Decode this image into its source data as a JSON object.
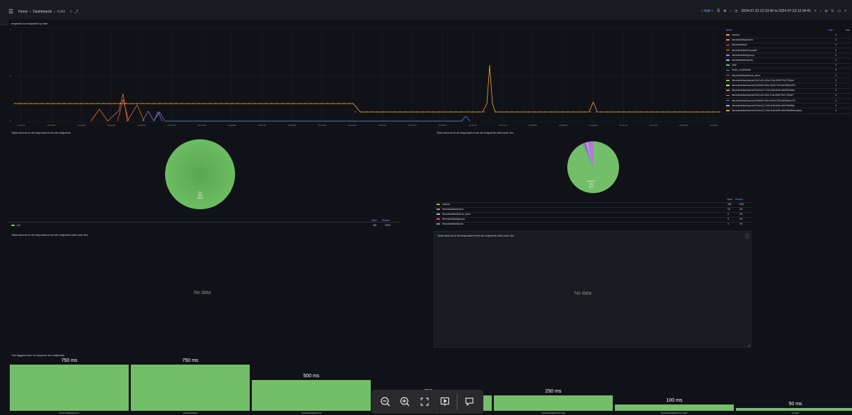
{
  "breadcrumb": [
    "Home",
    "Dashboards",
    "Kafdl"
  ],
  "topbar": {
    "add": "Add",
    "time_range": "2024-07-23 12:10:40 to 2024-07-23 12:34:41"
  },
  "panels": {
    "timeseries": {
      "title": "requests to endpoints by time",
      "legend_header": {
        "name": "Name",
        "last": "Last *",
        "max": "Max"
      },
      "legend": [
        {
          "name": "/metrics",
          "color": "#f2a93b",
          "last": "0"
        },
        {
          "name": "/tenants/default/users",
          "color": "#ff7a2e",
          "last": "0"
        },
        {
          "name": "/tenants/default",
          "color": "#ff5f3a",
          "last": "0"
        },
        {
          "name": "/tenants/default/corporate",
          "color": "#ff9830",
          "last": "0"
        },
        {
          "name": "/tenants/default/groups",
          "color": "#b877d9",
          "last": "0"
        },
        {
          "name": "/tenants/default/posts",
          "color": "#8ab8ff",
          "last": "0"
        },
        {
          "name": "/auth",
          "color": "#73bf69",
          "last": "0"
        },
        {
          "name": "/redoc_conf/default",
          "color": "#5794f2",
          "last": "0"
        },
        {
          "name": "/tenants/default/check_token",
          "color": "#f2495c",
          "last": "0"
        },
        {
          "name": "/tenants/default/users/e23c7c12c-f10e-47a6-89f5-97b1729bbe7",
          "color": "#73bf69",
          "last": "0"
        },
        {
          "name": "/tenants/default/users/c22c5525-09be-4450-9705-6603f9ebc975",
          "color": "#fade2a",
          "last": "0"
        },
        {
          "name": "/tenants/default/users/e21efcc12-17e8-4e6d-8ef5-c6fb7f6d5bba",
          "color": "#b877d9",
          "last": "0"
        },
        {
          "name": "/tenants/default/users/e23c7c12c-ff1d-47a6-89f5-97b1729bbe7",
          "color": "#ff7383",
          "last": "0"
        },
        {
          "name": "/tenants/default/users/c23c5525-09be-4450-9705-6603f9ebc975",
          "color": "#5794f2",
          "last": "0"
        },
        {
          "name": "/tenants/default/users/e21efcc12-17e8-4e6d-8ef5-c6fb7f6d5bba",
          "color": "#8ab8ff",
          "last": "0"
        },
        {
          "name": "/tenants/default/users/e21efcc12-17e8-4e6d-8ef5-c6fb7f6d5bba/replica",
          "color": "#ff9830",
          "last": "0"
        }
      ],
      "yticks": [
        "2",
        "1",
        "0"
      ],
      "xticks": [
        "13:11:00",
        "13:12:00",
        "13:13:00",
        "13:14:00",
        "13:15:00",
        "13:16:00",
        "13:17:00",
        "13:18:00",
        "13:19:00",
        "13:20:00",
        "13:21:00",
        "13:22:00",
        "13:23:00",
        "13:24:00",
        "13:25:00",
        "13:26:00",
        "13:27:00",
        "13:28:00",
        "13:29:00",
        "13:30:00",
        "13:31:00",
        "13:32:00",
        "13:33:00",
        "13:34:00"
      ]
    },
    "pie_all": {
      "title": "Total amount of all responses from all endpoints",
      "slice_label": "2xx",
      "slice_value": "463",
      "slice_pct": "100%",
      "legend_header": {
        "value": "Value",
        "percent": "Percent"
      },
      "legend": [
        {
          "name": "2xx",
          "value": "463",
          "pct": "100%",
          "color": "#73bf69"
        }
      ]
    },
    "pie_2xx": {
      "title": "Total amount of all responses from all endpoints with code 2xx",
      "slice_label": "/metrics",
      "slice_value": "439",
      "slice_pct": "94%",
      "legend_header": {
        "value": "Value",
        "percent": "Percent"
      },
      "legend": [
        {
          "name": "/metrics",
          "value": "439",
          "pct": "94%",
          "color": "#73bf69"
        },
        {
          "name": "/tenants/default/users",
          "value": "15",
          "pct": "3%",
          "color": "#b877d9"
        },
        {
          "name": "/tenants/default/check_token",
          "value": "3",
          "pct": "1%",
          "color": "#8ab8ff"
        },
        {
          "name": "/tenants/default/groups",
          "value": "3",
          "pct": "1%",
          "color": "#f2495c"
        },
        {
          "name": "/tenants/default/posts",
          "value": "3",
          "pct": "1%",
          "color": "#5794f2"
        }
      ]
    },
    "code5xx": {
      "title": "Total amount of all responses from all endpoints with code 5xx",
      "empty": "No data"
    },
    "code4xx": {
      "title": "Total amount of all responses from all endpoints with code 4xx",
      "empty": "No data"
    },
    "biggest": {
      "title": "The biggest time of response for endpoints"
    }
  },
  "chart_data": {
    "type": "bar",
    "title": "The biggest time of response for endpoints",
    "categories": [
      "/tenants/default/users",
      "/tenants/default",
      "/tenants/default/posts",
      "/tenants/default/groups",
      "/tenants/default/corporate",
      "/tenants/default/check_token",
      "/metrics"
    ],
    "values": [
      750,
      750,
      500,
      250,
      250,
      100,
      50
    ],
    "value_labels": [
      "750 ms",
      "750 ms",
      "500 ms",
      "250 ms",
      "250 ms",
      "100 ms",
      "50 ms"
    ],
    "ylim": [
      0,
      750
    ]
  },
  "zoom_toolbar": [
    "zoom-out",
    "zoom-in",
    "fit-screen",
    "present",
    "comment"
  ]
}
